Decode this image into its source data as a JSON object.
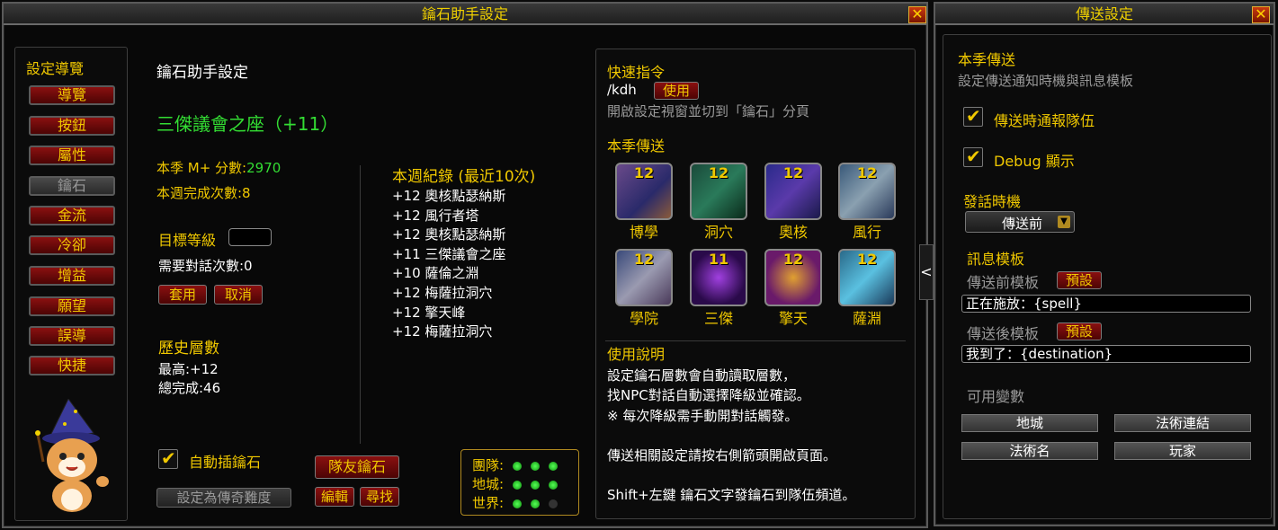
{
  "main_window": {
    "title": "鑰石助手設定",
    "close_glyph": "✕"
  },
  "nav": {
    "heading": "設定導覽",
    "items": [
      "導覽",
      "按鈕",
      "屬性",
      "鑰石",
      "金流",
      "冷卻",
      "增益",
      "願望",
      "誤導",
      "快捷"
    ],
    "active_index": 3
  },
  "center": {
    "heading": "鑰石助手設定",
    "dungeon": "三傑議會之座（+11）",
    "season_score_label": "本季 M+ 分數:",
    "season_score_value": "2970",
    "week_done": "本週完成次數:8",
    "target_label": "目標等級",
    "talks_needed": "需要對話次數:0",
    "apply": "套用",
    "cancel": "取消",
    "history_heading": "歷史層數",
    "history_max": "最高:+12",
    "history_total": "總完成:46",
    "auto_insert": "自動插鑰石",
    "set_legend": "設定為傳奇難度",
    "party_key": "隊友鑰石",
    "edit": "編輯",
    "find": "尋找",
    "status_labels": [
      "團隊:",
      "地城:",
      "世界:"
    ]
  },
  "weekly": {
    "heading": "本週紀錄 (最近10次)",
    "runs": [
      "+12 奧核點瑟納斯",
      "+12 風行者塔",
      "+12 奧核點瑟納斯",
      "+11 三傑議會之座",
      "+10 薩倫之淵",
      "+12 梅薩拉洞穴",
      "+12 擎天峰",
      "+12 梅薩拉洞穴"
    ]
  },
  "right_panel": {
    "quick_heading": "快速指令",
    "command": "/kdh",
    "use": "使用",
    "quick_desc": "開啟設定視窗並切到「鑰石」分頁",
    "season_heading": "本季傳送",
    "dungeons": [
      {
        "level": "12",
        "name": "博學"
      },
      {
        "level": "12",
        "name": "洞穴"
      },
      {
        "level": "12",
        "name": "奧核"
      },
      {
        "level": "12",
        "name": "風行"
      },
      {
        "level": "12",
        "name": "學院"
      },
      {
        "level": "11",
        "name": "三傑"
      },
      {
        "level": "12",
        "name": "擎天"
      },
      {
        "level": "12",
        "name": "薩淵"
      }
    ],
    "usage_heading": "使用說明",
    "usage_lines": [
      "設定鑰石層數會自動讀取層數，",
      "找NPC對話自動選擇降級並確認。",
      "※ 每次降級需手動開對話觸發。",
      "",
      "傳送相關設定請按右側箭頭開啟頁面。",
      "",
      "Shift+左鍵 鑰石文字發鑰石到隊伍頻道。"
    ]
  },
  "teleport_window": {
    "title": "傳送設定",
    "heading": "本季傳送",
    "subheading": "設定傳送通知時機與訊息模板",
    "notify_party": "傳送時通報隊伍",
    "debug": "Debug 顯示",
    "timing_label": "發話時機",
    "timing_value": "傳送前",
    "template_heading": "訊息模板",
    "before_label": "傳送前模板",
    "before_default": "預設",
    "before_value": "正在施放：{spell}",
    "after_label": "傳送後模板",
    "after_default": "預設",
    "after_value": "我到了：{destination}",
    "vars_heading": "可用變數",
    "vars": [
      "地城",
      "法術連結",
      "法術名",
      "玩家"
    ]
  },
  "side_arrow": "<",
  "colors": {
    "accent_yellow": "#f0c800",
    "dungeon_green": "#33dd33",
    "button_red": "#8a1010"
  }
}
